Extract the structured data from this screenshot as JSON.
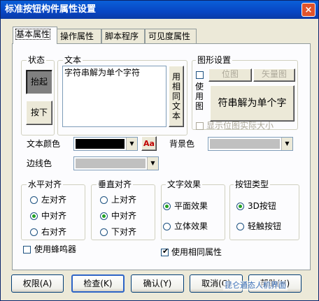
{
  "window": {
    "title": "标准按钮构件属性设置",
    "close_label": "×"
  },
  "tabs": [
    {
      "label": "基本属性",
      "active": true
    },
    {
      "label": "操作属性",
      "active": false
    },
    {
      "label": "脚本程序",
      "active": false
    },
    {
      "label": "可见度属性",
      "active": false
    }
  ],
  "state_group": {
    "label": "状态",
    "up_label": "抬起",
    "down_label": "按下"
  },
  "text_group": {
    "label": "文本",
    "value": "字符串解为单个字符",
    "same_text_button": "用相同文本"
  },
  "graphic_group": {
    "label": "图形设置",
    "use_graphic_label": "使用图",
    "bitmap_button": "位图",
    "vector_button": "矢量图",
    "preview_text": "符串解为单个字",
    "actual_size_label": "显示位图实际大小"
  },
  "text_color": {
    "label": "文本颜色",
    "value": "#000000",
    "font_icon": "Aa"
  },
  "bg_color": {
    "label": "背景色",
    "value": "#c0c0c0"
  },
  "border_color": {
    "label": "边线色",
    "value": "#c0c0c0"
  },
  "h_align": {
    "label": "水平对齐",
    "options": [
      "左对齐",
      "中对齐",
      "右对齐"
    ],
    "selected": 1
  },
  "v_align": {
    "label": "垂直对齐",
    "options": [
      "上对齐",
      "中对齐",
      "下对齐"
    ],
    "selected": 1
  },
  "text_effect": {
    "label": "文字效果",
    "options": [
      "平面效果",
      "立体效果"
    ],
    "selected": 0
  },
  "button_type": {
    "label": "按钮类型",
    "options": [
      "3D按钮",
      "轻触按钮"
    ],
    "selected": 0
  },
  "use_buzzer": {
    "label": "使用蜂鸣器",
    "checked": false
  },
  "use_same_attrs": {
    "label": "使用相同属性",
    "checked": true
  },
  "footer": {
    "permission": "权限(A)",
    "check": "检查(K)",
    "confirm": "确认(Y)",
    "cancel": "取消(C)",
    "help": "帮助(H)"
  },
  "watermark": "昆仑通态人机界面"
}
